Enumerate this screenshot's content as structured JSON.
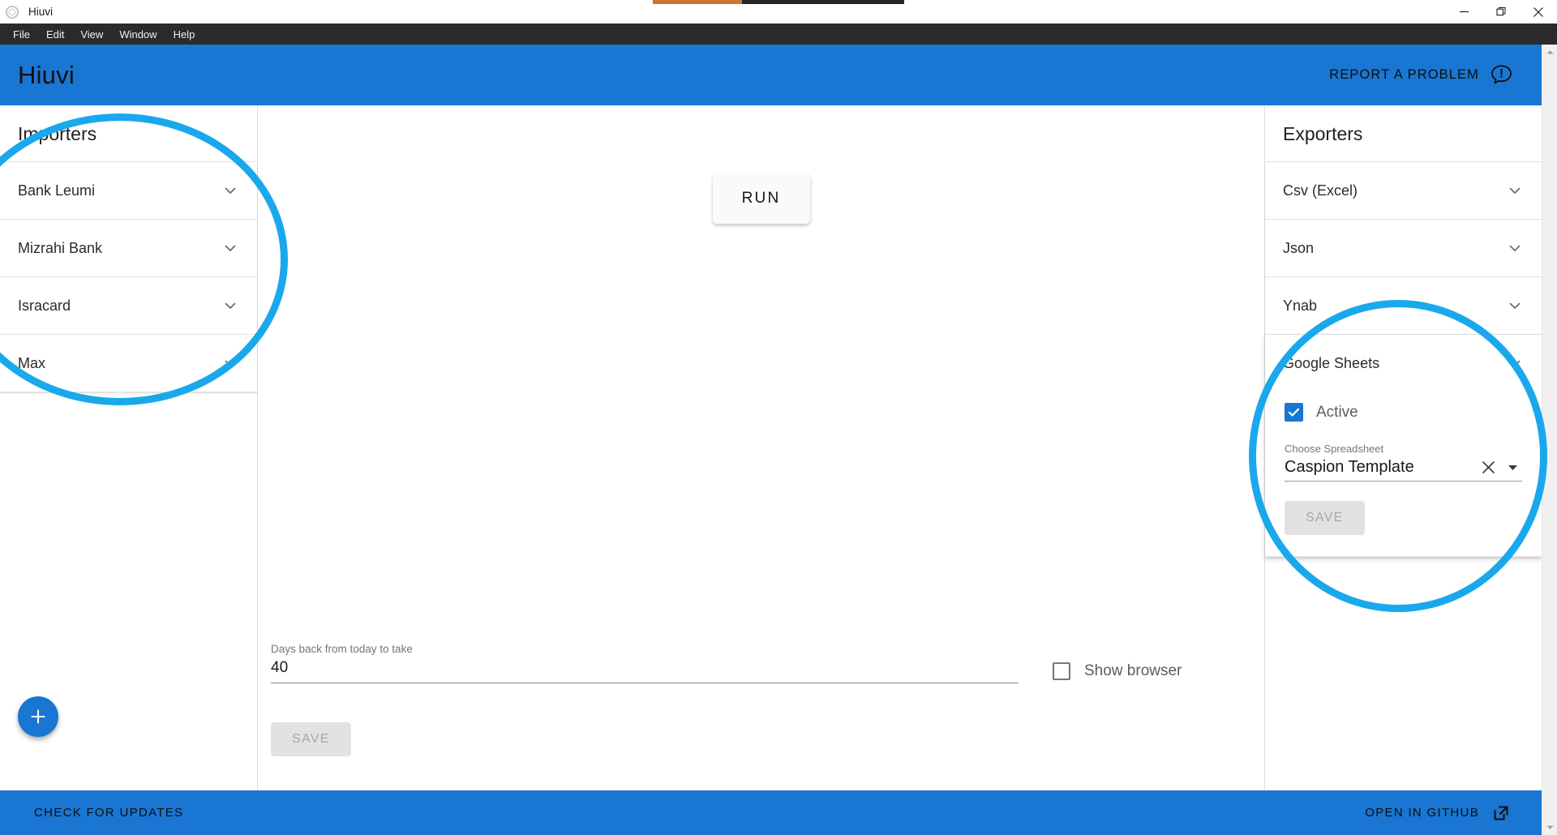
{
  "window": {
    "title": "Hiuvi",
    "app_icon": "app-logo-icon",
    "controls": {
      "minimize": "minimize-icon",
      "maximize": "restore-icon",
      "close": "close-icon"
    },
    "progress_strip": {
      "left_color": "#c9762a",
      "right_color": "#262626"
    }
  },
  "menubar": {
    "items": [
      {
        "label": "File"
      },
      {
        "label": "Edit"
      },
      {
        "label": "View"
      },
      {
        "label": "Window"
      },
      {
        "label": "Help"
      }
    ]
  },
  "header": {
    "title": "Hiuvi",
    "background": "#1976d2",
    "report_problem": {
      "label": "REPORT A PROBLEM",
      "icon": "feedback-icon"
    }
  },
  "importers": {
    "title": "Importers",
    "items": [
      {
        "label": "Bank Leumi",
        "expanded": false
      },
      {
        "label": "Mizrahi Bank",
        "expanded": false
      },
      {
        "label": "Isracard",
        "expanded": false
      },
      {
        "label": "Max",
        "expanded": false
      }
    ]
  },
  "exporters": {
    "title": "Exporters",
    "items": [
      {
        "label": "Csv (Excel)",
        "expanded": false
      },
      {
        "label": "Json",
        "expanded": false
      },
      {
        "label": "Ynab",
        "expanded": false
      },
      {
        "label": "Google Sheets",
        "expanded": true
      }
    ],
    "google_sheets": {
      "active_label": "Active",
      "active_checked": true,
      "spreadsheet_label": "Choose Spreadsheet",
      "spreadsheet_value": "Caspion Template",
      "clear_icon": "close-icon",
      "dropdown_icon": "caret-down-icon",
      "save_label": "SAVE"
    }
  },
  "main": {
    "run_label": "RUN",
    "days_back": {
      "label": "Days back from today to take",
      "value": "40",
      "placeholder": "40"
    },
    "show_browser": {
      "label": "Show browser",
      "checked": false
    },
    "save_label": "SAVE",
    "add_label": "+"
  },
  "footer": {
    "check_for_updates": "CHECK FOR UPDATES",
    "open_in_github": "OPEN IN GITHUB",
    "github_icon": "external-link-icon"
  },
  "scrollbar": {
    "up_icon": "caret-up-icon",
    "down_icon": "caret-down-icon"
  },
  "annotations": {
    "color": "#19a8ec",
    "shapes": [
      {
        "name": "importers-highlight"
      },
      {
        "name": "google-sheets-highlight"
      }
    ]
  }
}
